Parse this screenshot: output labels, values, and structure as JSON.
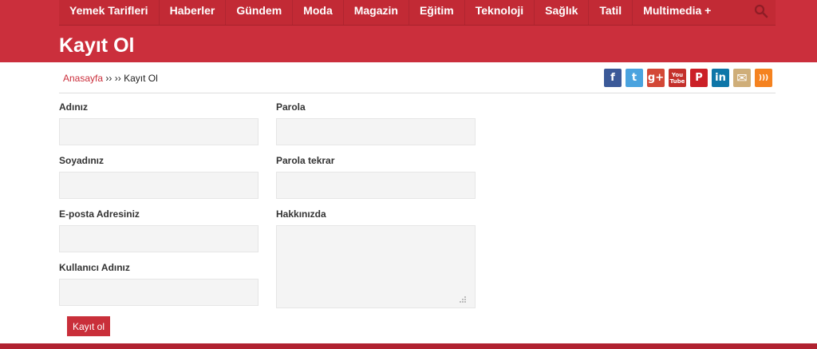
{
  "nav": {
    "items": [
      "Yemek Tarifleri",
      "Haberler",
      "Gündem",
      "Moda",
      "Magazin",
      "Eğitim",
      "Teknoloji",
      "Sağlık",
      "Tatil",
      "Multimedia +"
    ]
  },
  "page": {
    "title": "Kayıt Ol"
  },
  "breadcrumb": {
    "home": "Anasayfa",
    "separator": "›› ››",
    "current": "Kayıt Ol"
  },
  "social": {
    "icons": [
      "facebook-icon",
      "twitter-icon",
      "google-plus-icon",
      "youtube-icon",
      "pinterest-icon",
      "linkedin-icon",
      "email-icon",
      "rss-icon"
    ],
    "glyphs": [
      "f",
      "t",
      "g+",
      "You Tube",
      "P",
      "in",
      "✉",
      ")))"
    ],
    "colors": [
      "#3b5998",
      "#4aa3df",
      "#d34836",
      "#c4302b",
      "#cb2027",
      "#0e76a8",
      "#cfae79",
      "#f5821f"
    ]
  },
  "form": {
    "first_name_label": "Adınız",
    "last_name_label": "Soyadınız",
    "email_label": "E-posta Adresiniz",
    "username_label": "Kullanıcı Adınız",
    "password_label": "Parola",
    "password_repeat_label": "Parola tekrar",
    "about_label": "Hakkınızda",
    "submit_label": "Kayıt ol"
  },
  "colors": {
    "brand_red": "#cb2f3c",
    "input_bg": "#f4f4f4"
  }
}
